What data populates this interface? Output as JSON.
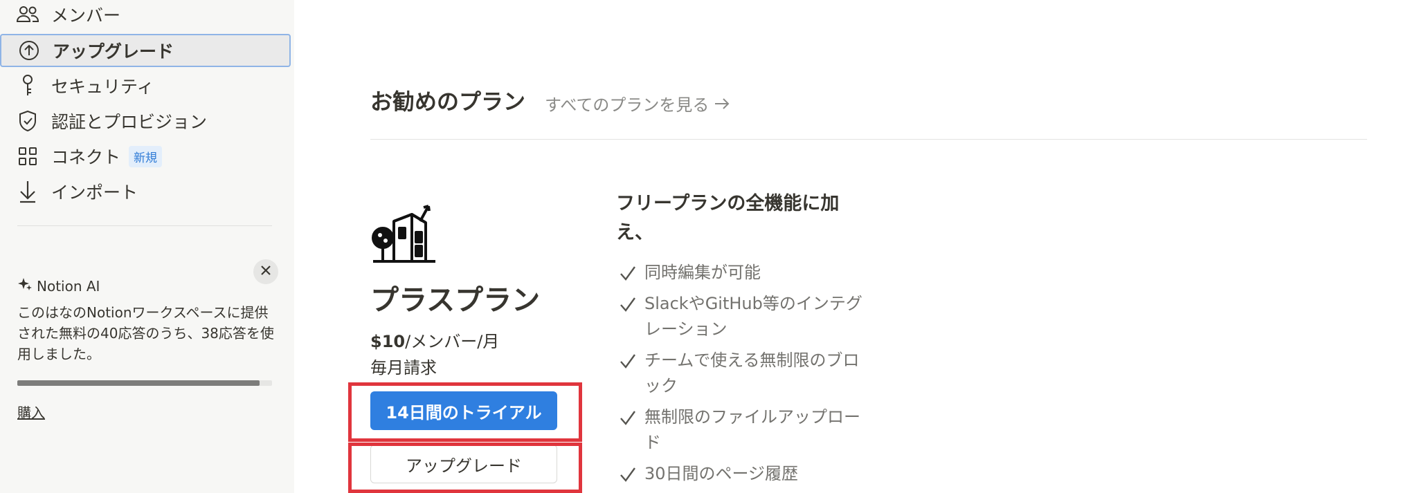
{
  "sidebar": {
    "items": [
      {
        "label": "メンバー",
        "icon": "members-icon"
      },
      {
        "label": "アップグレード",
        "icon": "upgrade-circle-icon",
        "active": true
      },
      {
        "label": "セキュリティ",
        "icon": "key-icon"
      },
      {
        "label": "認証とプロビジョン",
        "icon": "shield-check-icon"
      },
      {
        "label": "コネクト",
        "icon": "grid-icon",
        "badge": "新規"
      },
      {
        "label": "インポート",
        "icon": "download-arrow-icon"
      }
    ],
    "ai_panel": {
      "title": "Notion AI",
      "description": "このはなのNotionワークスペースに提供された無料の40応答のうち、38応答を使用しました。",
      "used": 38,
      "total": 40,
      "buy_label": "購入"
    }
  },
  "main": {
    "heading": "お勧めのプラン",
    "see_all": "すべてのプランを見る",
    "plan": {
      "name": "プラスプラン",
      "price": "$10",
      "price_unit": "/メンバー/月",
      "billing": "毎月請求",
      "trial_label": "14日間のトライアル",
      "upgrade_label": "アップグレード"
    },
    "features_title": "フリープランの全機能に加え、",
    "features": [
      "同時編集が可能",
      "SlackやGitHub等のインテグレーション",
      "チームで使える無制限のブロック",
      "無制限のファイルアップロード",
      "30日間のページ履歴"
    ]
  },
  "colors": {
    "accent": "#2f7fe0",
    "highlight": "#e0353d",
    "sidebar_bg": "#f7f7f5"
  }
}
